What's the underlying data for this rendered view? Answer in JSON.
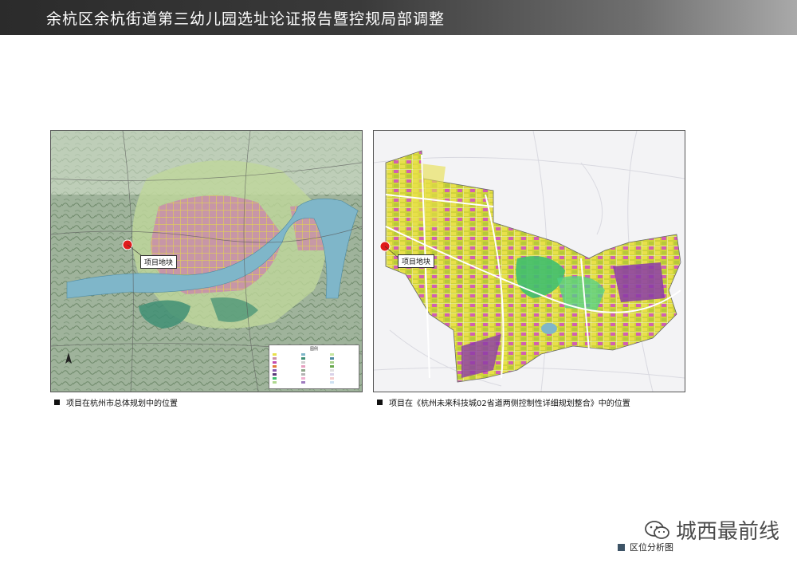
{
  "header": {
    "title": "余杭区余杭街道第三幼儿园选址论证报告暨控规局部调整"
  },
  "maps": {
    "left": {
      "pin_label": "项目地块",
      "caption": "项目在杭州市总体规划中的位置",
      "legend_title": "图例"
    },
    "right": {
      "pin_label": "项目地块",
      "caption": "项目在《杭州未来科技城02省道两侧控制性详细规划整合》中的位置"
    }
  },
  "watermark": {
    "text": "城西最前线",
    "icon": "wechat-icon"
  },
  "section": {
    "label": "区位分析图"
  },
  "colors": {
    "title_bar": "#3a3a3a",
    "pin": "#e01b1b",
    "section_marker": "#3d5366",
    "residential": "#e8e04a",
    "commercial": "#c24bb0",
    "green": "#3fbf6f",
    "water": "#7fb6c9",
    "terrain": "#8ea68a"
  }
}
